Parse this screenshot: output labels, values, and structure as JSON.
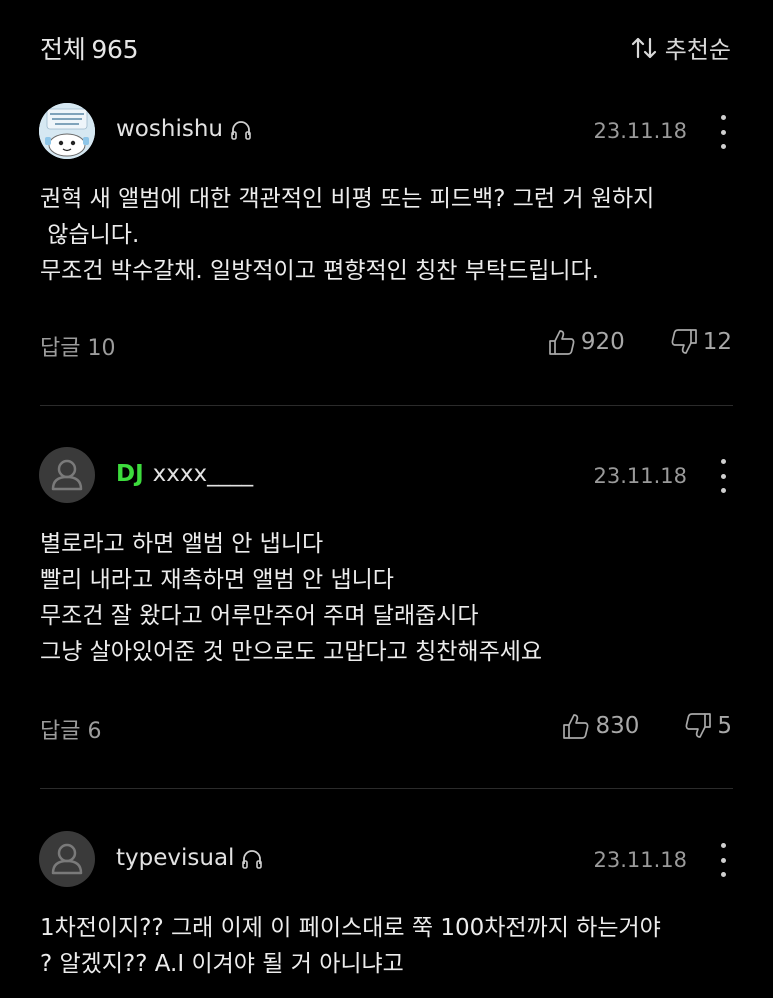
{
  "header": {
    "total_label": "전체",
    "total_count": "965",
    "sort_label": "추천순"
  },
  "comments": [
    {
      "username": "woshishu",
      "has_dj_badge": false,
      "date": "23.11.18",
      "lines": [
        "권혁 새 앨범에 대한 객관적인 비평 또는 피드백? 그런 거 원하지",
        " 않습니다.",
        "무조건 박수갈채. 일방적이고 편향적인 칭찬 부탁드립니다."
      ],
      "reply_label": "답글",
      "reply_count": "10",
      "likes": "920",
      "dislikes": "12"
    },
    {
      "username": "xxxx____",
      "badge": "DJ",
      "has_dj_badge": true,
      "date": "23.11.18",
      "lines": [
        "별로라고 하면 앨범 안 냅니다",
        "빨리 내라고 재촉하면 앨범 안 냅니다",
        "무조건 잘 왔다고 어루만주어 주며 달래줍시다",
        "그냥 살아있어준 것 만으로도 고맙다고 칭찬해주세요"
      ],
      "reply_label": "답글",
      "reply_count": "6",
      "likes": "830",
      "dislikes": "5"
    },
    {
      "username": "typevisual",
      "has_dj_badge": false,
      "date": "23.11.18",
      "lines": [
        "1차전이지?? 그래 이제 이 페이스대로 쭉 100차전까지 하는거야",
        "? 알겠지?? A.I 이겨야 될 거 아니냐고"
      ]
    }
  ],
  "colors": {
    "background": "#000000",
    "text": "#ececec",
    "muted": "#9a9a9a",
    "dj_badge": "#3ddc3d",
    "divider": "#2b2b2b"
  },
  "icons": [
    "sort-arrows-icon",
    "headphone-icon",
    "more-vertical-icon",
    "thumbs-up-icon",
    "thumbs-down-icon",
    "default-avatar-icon"
  ]
}
